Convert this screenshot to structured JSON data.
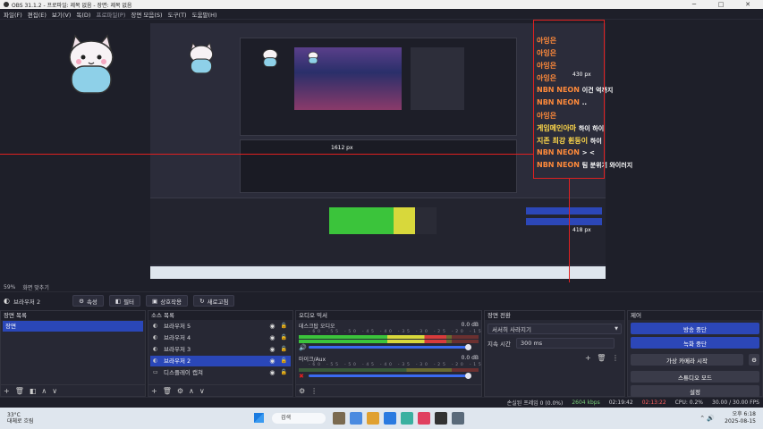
{
  "window": {
    "title": "OBS 31.1.2 - 프로파일: 제목 없음 - 장면: 제목 없음"
  },
  "menu": [
    "파일(F)",
    "편집(E)",
    "보기(V)",
    "독(D)",
    "프로파일(P)",
    "장면 모음(S)",
    "도구(T)",
    "도움말(H)"
  ],
  "chat": [
    {
      "name": "아잉은",
      "text": "",
      "color": "#ff8a3a"
    },
    {
      "name": "아잉은",
      "text": "",
      "color": "#ff8a3a"
    },
    {
      "name": "아잉은",
      "text": "",
      "color": "#ff8a3a"
    },
    {
      "name": "아잉은",
      "text": "",
      "color": "#ff8a3a"
    },
    {
      "name": "NBN NEON",
      "text": "이건 억까지",
      "color": "#ff8a3a"
    },
    {
      "name": "NBN NEON",
      "text": "..",
      "color": "#ff8a3a"
    },
    {
      "name": "아잉은",
      "text": "",
      "color": "#ff8a3a"
    },
    {
      "name": "게임메인아마",
      "text": "하이 하이",
      "color": "#ffd84a"
    },
    {
      "name": "지존 최강 휜둥이",
      "text": "하이",
      "color": "#ffd84a"
    },
    {
      "name": "NBN NEON",
      "text": "> <",
      "color": "#ff8a3a"
    },
    {
      "name": "NBN NEON",
      "text": "팀 분위기 와이러지",
      "color": "#ff8a3a"
    }
  ],
  "measure": {
    "top": "430 px",
    "right": "418 px",
    "mid": "1612 px"
  },
  "statusline": {
    "zoom": "59%",
    "fit_label": "화면 맞추기"
  },
  "context": {
    "source_name": "브라우저 2",
    "buttons": [
      "속성",
      "필터",
      "상호작용",
      "새로고침"
    ]
  },
  "scenes": {
    "title": "장면 목록",
    "items": [
      "장면"
    ]
  },
  "sources": {
    "title": "소스 목록",
    "items": [
      {
        "name": "브라우저 5",
        "selected": false
      },
      {
        "name": "브라우저 4",
        "selected": false
      },
      {
        "name": "브라우저 3",
        "selected": false
      },
      {
        "name": "브라우저 2",
        "selected": true
      },
      {
        "name": "디스플레이 캡쳐",
        "selected": false
      }
    ]
  },
  "mixer": {
    "title": "오디오 믹서",
    "channels": [
      {
        "name": "데스크탑 오디오",
        "db": "0.0 dB",
        "level": 0.82
      },
      {
        "name": "마이크/Aux",
        "db": "0.0 dB",
        "level": 0.0
      }
    ],
    "ticks": "-60 -55 -50 -45 -40 -35 -30 -25 -20 -15 -10 -5 0"
  },
  "transition": {
    "title": "장면 전환",
    "selected": "서서히 사라지기",
    "duration_label": "지속 시간",
    "duration": "300 ms"
  },
  "controls": {
    "title": "제어",
    "buttons": [
      {
        "label": "방송 중단",
        "style": "blue"
      },
      {
        "label": "녹화 중단",
        "style": "blue"
      },
      {
        "label": "가상 카메라 시작",
        "style": "gray"
      },
      {
        "label": "스튜디오 모드",
        "style": "gray"
      },
      {
        "label": "설정",
        "style": "gray"
      }
    ]
  },
  "status": {
    "dropped": "손실된 프레임 0 (0.0%)",
    "bitrate": "2604 kbps",
    "stream_time": "02:19:42",
    "rec_time": "02:13:22",
    "cpu": "CPU: 0.2%",
    "fps": "30.00 / 30.00 FPS"
  },
  "taskbar": {
    "temp": "33°C",
    "weather": "대체로 흐림",
    "search": "검색",
    "time": "오후 6:18",
    "date": "2025-08-15"
  },
  "colors": {
    "accent": "#2c47b8",
    "red": "#e02020",
    "bg": "#1e1f29"
  }
}
